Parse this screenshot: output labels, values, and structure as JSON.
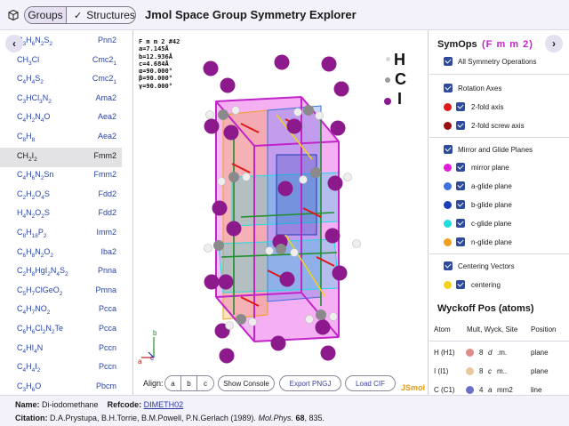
{
  "header": {
    "groups_label": "Groups",
    "structures_label": "Structures",
    "title": "Jmol Space Group Symmetry Explorer"
  },
  "nav": {
    "back_icon": "chevron-left-icon",
    "forward_icon": "chevron-right-icon"
  },
  "structures": [
    {
      "formula": "C3H6N2S2",
      "group": "Pnn2"
    },
    {
      "formula": "CH3Cl",
      "group": "Cmc21"
    },
    {
      "formula": "C4H4S2",
      "group": "Cmc21"
    },
    {
      "formula": "C3HCl3N2",
      "group": "Ama2"
    },
    {
      "formula": "C4H2N4O",
      "group": "Aea2"
    },
    {
      "formula": "C8H8",
      "group": "Aea2"
    },
    {
      "formula": "CH2I2",
      "group": "Fmm2",
      "selected": true
    },
    {
      "formula": "C4H6N2Sn",
      "group": "Fmm2"
    },
    {
      "formula": "C2H2O4S",
      "group": "Fdd2"
    },
    {
      "formula": "H4N2O2S",
      "group": "Fdd2"
    },
    {
      "formula": "C8H18P2",
      "group": "Imm2"
    },
    {
      "formula": "C6H8N2O2",
      "group": "Iba2"
    },
    {
      "formula": "C2H8HgI2N4S2",
      "group": "Pnna"
    },
    {
      "formula": "C5H7ClGeO2",
      "group": "Pmna"
    },
    {
      "formula": "C4H7NO2",
      "group": "Pcca"
    },
    {
      "formula": "C6H6Cl2N2Te",
      "group": "Pcca"
    },
    {
      "formula": "C4HI4N",
      "group": "Pccn"
    },
    {
      "formula": "C4H4I2",
      "group": "Pccn"
    },
    {
      "formula": "C3H6O",
      "group": "Pbcm"
    }
  ],
  "viewer": {
    "cell_info": "F m m 2 #42\na=7.145Å\nb=12.936Å\nc=4.684Å\nα=90.000°\nβ=90.000°\nγ=90.000°",
    "atom_legend": {
      "h": "H",
      "c": "C",
      "i": "I"
    },
    "axis_labels": {
      "a": "a",
      "b": "b",
      "c": "c"
    },
    "align_label": "Align:",
    "align_buttons": [
      "a",
      "b",
      "c"
    ],
    "show_console": "Show Console",
    "export_png": "Export PNGJ",
    "load_cif": "Load CIF",
    "jsmol": "JSmol"
  },
  "symops": {
    "title": "SymOps",
    "space_group": "(F m m 2)",
    "all_label": "All Symmetry Operations",
    "rotation_axes": "Rotation Axes",
    "twofold_axis": "2-fold axis",
    "twofold_screw": "2-fold screw axis",
    "mirror_glide": "Mirror and Glide Planes",
    "mirror_plane": "mirror plane",
    "a_glide": "a-glide plane",
    "b_glide": "b-glide plane",
    "c_glide": "c-glide plane",
    "n_glide": "n-glide plane",
    "centering_vectors": "Centering Vectors",
    "centering": "centering"
  },
  "colors": {
    "twofold_axis": "#e01818",
    "twofold_screw": "#9a1010",
    "mirror": "#e21bdc",
    "a_glide": "#3d6fe0",
    "b_glide": "#1e3bb8",
    "c_glide": "#1fdde0",
    "n_glide": "#f0a020",
    "centering": "#f2d21a",
    "iodine": "#8c1a8c"
  },
  "wyckoff": {
    "title": "Wyckoff Pos (atoms)",
    "headers": {
      "atom": "Atom",
      "mult": "Mult, Wyck, Site",
      "position": "Position"
    },
    "rows": [
      {
        "atom": "H (H1)",
        "mult": "8",
        "wyck": "d",
        "site": ".m.",
        "position": "plane",
        "color": "#e08a8a"
      },
      {
        "atom": "I (I1)",
        "mult": "8",
        "wyck": "c",
        "site": "m..",
        "position": "plane",
        "color": "#e8c8a0"
      },
      {
        "atom": "C (C1)",
        "mult": "4",
        "wyck": "a",
        "site": "mm2",
        "position": "line",
        "color": "#6a70c8"
      }
    ]
  },
  "footer": {
    "name_label": "Name:",
    "name": "Di-iodomethane",
    "refcode_label": "Refcode:",
    "refcode": "DIMETH02",
    "citation_label": "Citation:",
    "citation_authors": "D.A.Prystupa, B.H.Torrie, B.M.Powell, P.N.Gerlach (1989).",
    "citation_journal": "Mol.Phys.",
    "citation_volume": "68",
    "citation_pages": ", 835."
  }
}
